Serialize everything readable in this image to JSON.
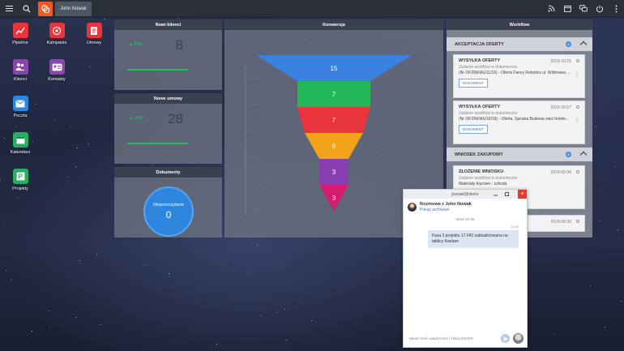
{
  "topbar": {
    "user_name": "John Nowak"
  },
  "desktop": {
    "apps": [
      {
        "label": "Pipeline"
      },
      {
        "label": "Kampanie"
      },
      {
        "label": "Umowy"
      },
      {
        "label": "Klienci"
      },
      {
        "label": "Kontakty"
      },
      {
        "label": "Poczta"
      },
      {
        "label": "Kalendarz"
      },
      {
        "label": "Projekty"
      }
    ]
  },
  "widgets": {
    "nowi_klienci": {
      "title": "Nowi klienci",
      "change": "10%",
      "value": "8"
    },
    "nowe_umowy": {
      "title": "Nowe umowy",
      "change": "10%",
      "value": "28"
    },
    "dokumenty": {
      "title": "Dokumenty",
      "label": "Nieprzeczytane",
      "value": "0"
    },
    "konwersja": {
      "title": "Konwersja",
      "y_labels": [
        "100.00%",
        "80.00%",
        "60.00%",
        "40.00%",
        "20.00%",
        "0.00%"
      ],
      "stages": [
        {
          "value": "15",
          "color": "#3b82e0"
        },
        {
          "value": "7",
          "color": "#22b85a"
        },
        {
          "value": "7",
          "color": "#e8343a"
        },
        {
          "value": "6",
          "color": "#f2a31a"
        },
        {
          "value": "3",
          "color": "#8a3fb0"
        },
        {
          "value": "3",
          "color": "#d61b6e"
        }
      ]
    }
  },
  "workflow": {
    "title": "Workflow",
    "section1": {
      "title": "AKCEPTACJA OFERTY",
      "badge": "2",
      "cards": [
        {
          "title": "WYSYŁKA OFERTY",
          "date": "2019-10-15",
          "subtitle": "Zadanie workflow w dokumencie",
          "desc": "(Nr OF/DM/AS/11/19) - Oferta Fancy Robotics ul. Widmowa ...",
          "button": "DOKUMENT"
        },
        {
          "title": "WYSYŁKA OFERTY",
          "date": "2019-10-07",
          "subtitle": "Zadanie workflow w dokumencie",
          "desc": "(Nr OF/DM/AS/10/19) - Oferta. Sprawa Budowa sieci hotelo...",
          "button": "DOKUMENT"
        }
      ]
    },
    "section2": {
      "title": "WNIOSEK ZAKUPOWY",
      "badge": "6",
      "cards": [
        {
          "title": "ZŁOŻENIE WNIOSKU",
          "date": "2019-09-30",
          "subtitle": "Zadanie workflow w dokumencie",
          "desc": "Materiały biurowe - szkoda"
        },
        {
          "date": "2019-09-30"
        }
      ]
    }
  },
  "chat": {
    "window_title": "jnowak@demo",
    "with": "Rozmowa z John Nowak",
    "archive_link": "Pokaż archiwum",
    "date": "2019-10-25",
    "time": "14:05",
    "message": "Faza 3 projektu 17.042 zaktualizowana na tablicy Kanban",
    "input_placeholder": "Wpisz treść wiadomości i kliknij ENTER"
  },
  "colors": {
    "topbar": "#2a2f3a",
    "accent_orange": "#f15a24",
    "widget_header": "#3a404d",
    "positive_green": "#1fc15a",
    "link_blue": "#3b7ad8"
  }
}
